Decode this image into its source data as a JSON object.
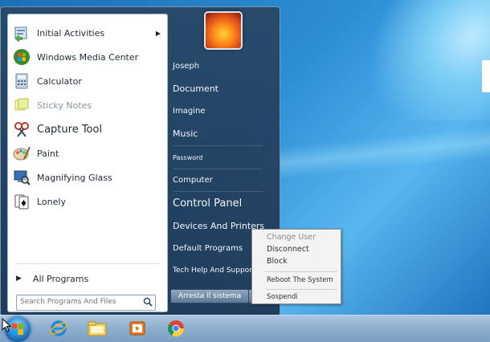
{
  "programs": [
    {
      "label": "Initial Activities",
      "icon": "initial-activities-icon",
      "has_submenu": true
    },
    {
      "label": "Windows Media Center",
      "icon": "windows-media-center-icon",
      "has_submenu": false
    },
    {
      "label": "Calculator",
      "icon": "calculator-icon",
      "has_submenu": false
    },
    {
      "label": "Sticky Notes",
      "icon": "sticky-notes-icon",
      "has_submenu": false
    },
    {
      "label": "Capture Tool",
      "icon": "capture-tool-icon",
      "has_submenu": false
    },
    {
      "label": "Paint",
      "icon": "paint-icon",
      "has_submenu": false
    },
    {
      "label": "Magnifying Glass",
      "icon": "magnifying-glass-icon",
      "has_submenu": false
    },
    {
      "label": "Lonely",
      "icon": "solitaire-icon",
      "has_submenu": false
    }
  ],
  "all_programs": "All Programs",
  "search": {
    "placeholder": "Search Programs And Files"
  },
  "right_links": [
    {
      "label": "Joseph"
    },
    {
      "label": "Document"
    },
    {
      "label": "Imagine"
    },
    {
      "label": "Music"
    },
    {
      "label": "Password"
    },
    {
      "label": "Computer"
    },
    {
      "label": "Control Panel"
    },
    {
      "label": "Devices And Printers"
    },
    {
      "label": "Default Programs"
    },
    {
      "label": "Tech Help And Support"
    }
  ],
  "shutdown": {
    "label": "Arresta il sistema",
    "arrow": "▸"
  },
  "power_menu": [
    {
      "label": "Change User"
    },
    {
      "label": "Disconnect"
    },
    {
      "label": "Block"
    },
    {
      "label": "Reboot The System"
    },
    {
      "label": "Sospendi"
    }
  ],
  "taskbar": {
    "items": [
      "windows-start-orb-icon",
      "internet-explorer-icon",
      "file-explorer-icon",
      "media-player-icon",
      "chrome-icon"
    ]
  },
  "colors": {
    "accent": "#2b7fc6",
    "menu_bg": "#2a4868"
  }
}
